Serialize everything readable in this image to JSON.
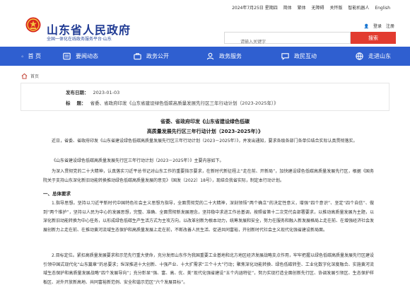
{
  "header": {
    "site_title": "山东省人民政府",
    "site_subtitle": "全国一体化在线政务服务平台·山东",
    "toplinks": [
      "2024年7月25日 星期四",
      "简体",
      "繁体",
      "无障碍",
      "关怀版",
      "智能机器人",
      "English"
    ],
    "login": [
      "登录",
      "注册"
    ],
    "search_placeholder": "请输入关键字",
    "search_button": "搜索"
  },
  "nav": {
    "items": [
      {
        "label": "首 页",
        "icon": "home-icon"
      },
      {
        "label": "要闻动态",
        "icon": "news-icon"
      },
      {
        "label": "政务公开",
        "icon": "briefcase-icon"
      },
      {
        "label": "政务服务",
        "icon": "service-icon"
      },
      {
        "label": "政民互动",
        "icon": "chat-icon"
      },
      {
        "label": "走进山东",
        "icon": "globe-icon"
      }
    ]
  },
  "breadcrumb": {
    "home": "首页"
  },
  "doc_info": {
    "date_label": "发布日期：",
    "date_value": "2023-01-03",
    "title_label": "标    题：",
    "title_value": "省委、省政府印发《山东省建设绿色低碳高质量发展先行区三年行动计划（2023-2025年）》"
  },
  "article": {
    "title1": "省委、省政府印发《山东省建设绿色低碳",
    "title2": "高质量发展先行区三年行动计划（2023-2025年）》",
    "p1": "近日，省委、省政府印发《山东省建设绿色低碳高质量发展先行区三年行动计划（2023－2025年）》，并发出通知，要求各级各部门各单位结合实际认真贯彻落实。",
    "p2": "《山东省建设绿色低碳高质量发展先行区三年行动计划（2023－2025年）》主要内容如下。",
    "p3": "为深入贯彻党的二十大精神，认真落实习近平总书记对山东工作的重要指示要求，在新时代新征程上“走在前、开新局”，加快建设绿色低碳高质量发展先行区，根据《国务院关于支持山东深化新旧动能转换推动绿色低碳高质量发展的意见》（国发〔2022〕18号），现结合我省实际，制定本行动计划。",
    "h1": "一、总体要求",
    "p4": "1.指导思想。坚持以习近平新时代中国特色社会主义思想为指导，全面贯彻党的二十大精神，深刻领悟“两个确立”的决定性意义，增强“四个意识”、坚定“四个自信”、做到“两个维护”，坚持以人民为中心的发展思想，完整、准确、全面贯彻新发展理念，坚持稳中求进工作总基调，按照省第十二次党代会部署要求，以推动高质量发展为主题，以深化新旧动能转换为中心任务，以形成绿色低碳生产生活方式为主攻方向，以改革创新为根本动力，统筹发展和安全，努力在服务和融入新发展格局上走在前、在增强经济社会发展创新力上走在前、在推动黄河流域生态保护和高质量发展上走在前，不断改善人民生活、促进共同富裕，开创新时代社会主义现代化强省建设新局面。",
    "p5": "2.目标定位。紧扣高质量发展要求和示范先行重大使命，充分发挥山东作为我国重要工业基地和北方地区经济发展战略支点作用，牢牢把握以绿色低碳高质量发展先行区建设引领中国式现代化“山东篇章”的总要求；纵深推进十大创新、十强产业、十大扩需求“三个十大”行动；聚焦深化动能转换、绿色低碳转型、工业化数字化深度融合、实施黄河流域生态保护和高质量发展战略“四个发展导向”；充分彰显“强、富、高、优、美”现代化强省建设“五个内涵特征”，努力实现打造全面创新先行区、协调发展引领区、生态保护样板区、对外开放新高地、共同富裕新范例、安全和谐示范区“六个发展目标”。"
  }
}
